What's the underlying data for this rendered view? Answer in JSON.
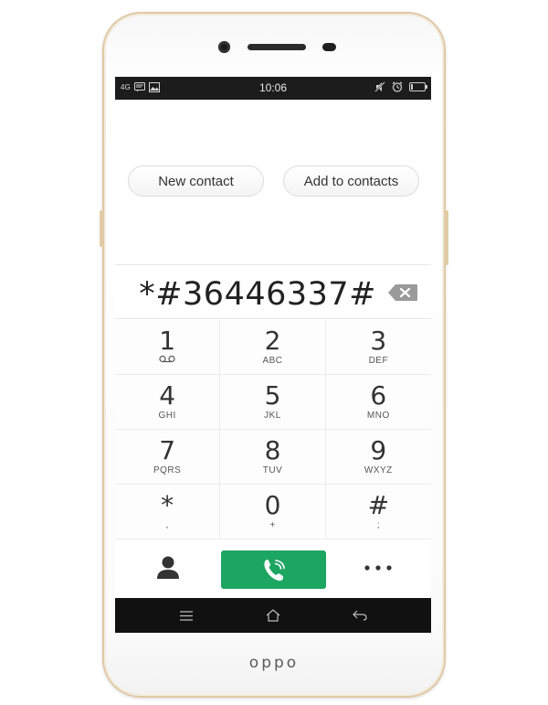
{
  "device": {
    "brand": "oppo"
  },
  "status_bar": {
    "network": "4G",
    "time": "10:06",
    "icons_left": [
      "network-icon",
      "messenger-icon",
      "image-icon"
    ],
    "icons_right": [
      "silent-icon",
      "alarm-icon",
      "battery-icon"
    ],
    "battery_level": 0.1
  },
  "contacts": {
    "new_contact_label": "New contact",
    "add_to_contacts_label": "Add to contacts"
  },
  "dialer": {
    "number": "*#36446337#",
    "keys": [
      {
        "digit": "1",
        "letters": ""
      },
      {
        "digit": "2",
        "letters": "ABC"
      },
      {
        "digit": "3",
        "letters": "DEF"
      },
      {
        "digit": "4",
        "letters": "GHI"
      },
      {
        "digit": "5",
        "letters": "JKL"
      },
      {
        "digit": "6",
        "letters": "MNO"
      },
      {
        "digit": "7",
        "letters": "PQRS"
      },
      {
        "digit": "8",
        "letters": "TUV"
      },
      {
        "digit": "9",
        "letters": "WXYZ"
      },
      {
        "digit": "*",
        "letters": ","
      },
      {
        "digit": "0",
        "letters": "+"
      },
      {
        "digit": "#",
        "letters": ";"
      }
    ],
    "call_color": "#1da562"
  },
  "navigation": {
    "items": [
      "menu-icon",
      "home-icon",
      "back-icon"
    ]
  }
}
